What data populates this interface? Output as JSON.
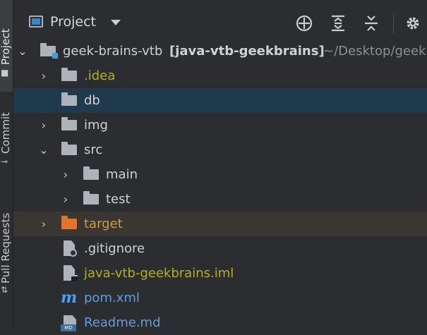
{
  "strip": {
    "tabs": [
      {
        "label": "Project",
        "active": true
      },
      {
        "label": "Commit",
        "active": false
      },
      {
        "label": "Pull Requests",
        "active": false
      }
    ]
  },
  "header": {
    "title": "Project",
    "actions": [
      "locate-icon",
      "expand-all-icon",
      "collapse-all-icon",
      "gear-icon"
    ]
  },
  "tree": {
    "root": {
      "name": "geek-brains-vtb",
      "module": "[java-vtb-geekbrains]",
      "path": "~/Desktop/geek-"
    },
    "rows": [
      {
        "label": ".idea"
      },
      {
        "label": "db"
      },
      {
        "label": "img"
      },
      {
        "label": "src"
      },
      {
        "label": "main"
      },
      {
        "label": "test"
      },
      {
        "label": "target"
      },
      {
        "label": ".gitignore"
      },
      {
        "label": "java-vtb-geekbrains.iml"
      },
      {
        "label": "pom.xml"
      },
      {
        "label": "Readme.md"
      }
    ],
    "md_badge": "MD"
  },
  "colors": {
    "background": "#2b2d30",
    "selected_row": "#1f3a4d",
    "excluded_row": "#3a3632",
    "vcs_modified": "#b3ae28",
    "excluded_folder": "#e07530",
    "maven": "#4ba0e6"
  }
}
